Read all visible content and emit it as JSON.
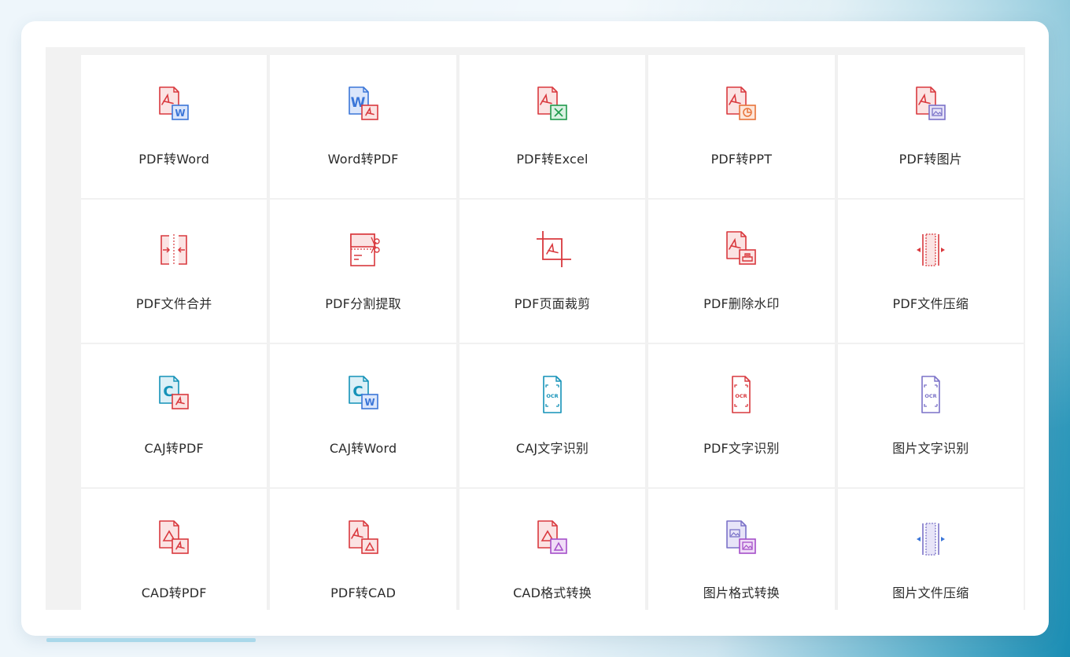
{
  "colors": {
    "pdf_red": "#d9393e",
    "pdf_fill": "#fbe3e3",
    "word_blue": "#3b76d8",
    "word_fill": "#dbe6fb",
    "excel_green": "#1f9a4c",
    "excel_fill": "#d9f1e2",
    "ppt_orange": "#e8743b",
    "ppt_fill": "#fde6d9",
    "caj_teal": "#1492b8",
    "caj_fill": "#dcf0f7",
    "purple": "#7b72c8",
    "purple_fill": "#e7e4f8",
    "magenta": "#a54fc9",
    "magenta_fill": "#f0ddf7"
  },
  "tools": [
    {
      "label": "PDF转Word",
      "icon": "pdf-to-word-icon",
      "name": "tool-pdf-to-word"
    },
    {
      "label": "Word转PDF",
      "icon": "word-to-pdf-icon",
      "name": "tool-word-to-pdf"
    },
    {
      "label": "PDF转Excel",
      "icon": "pdf-to-excel-icon",
      "name": "tool-pdf-to-excel"
    },
    {
      "label": "PDF转PPT",
      "icon": "pdf-to-ppt-icon",
      "name": "tool-pdf-to-ppt"
    },
    {
      "label": "PDF转图片",
      "icon": "pdf-to-image-icon",
      "name": "tool-pdf-to-image"
    },
    {
      "label": "PDF文件合并",
      "icon": "pdf-merge-icon",
      "name": "tool-pdf-merge"
    },
    {
      "label": "PDF分割提取",
      "icon": "pdf-split-icon",
      "name": "tool-pdf-split"
    },
    {
      "label": "PDF页面裁剪",
      "icon": "pdf-crop-icon",
      "name": "tool-pdf-crop"
    },
    {
      "label": "PDF删除水印",
      "icon": "pdf-remove-watermark-icon",
      "name": "tool-pdf-remove-watermark"
    },
    {
      "label": "PDF文件压缩",
      "icon": "pdf-compress-icon",
      "name": "tool-pdf-compress"
    },
    {
      "label": "CAJ转PDF",
      "icon": "caj-to-pdf-icon",
      "name": "tool-caj-to-pdf"
    },
    {
      "label": "CAJ转Word",
      "icon": "caj-to-word-icon",
      "name": "tool-caj-to-word"
    },
    {
      "label": "CAJ文字识别",
      "icon": "caj-ocr-icon",
      "name": "tool-caj-ocr"
    },
    {
      "label": "PDF文字识别",
      "icon": "pdf-ocr-icon",
      "name": "tool-pdf-ocr"
    },
    {
      "label": "图片文字识别",
      "icon": "image-ocr-icon",
      "name": "tool-image-ocr"
    },
    {
      "label": "CAD转PDF",
      "icon": "cad-to-pdf-icon",
      "name": "tool-cad-to-pdf"
    },
    {
      "label": "PDF转CAD",
      "icon": "pdf-to-cad-icon",
      "name": "tool-pdf-to-cad"
    },
    {
      "label": "CAD格式转换",
      "icon": "cad-convert-icon",
      "name": "tool-cad-convert"
    },
    {
      "label": "图片格式转换",
      "icon": "image-convert-icon",
      "name": "tool-image-convert"
    },
    {
      "label": "图片文件压缩",
      "icon": "image-compress-icon",
      "name": "tool-image-compress"
    }
  ]
}
